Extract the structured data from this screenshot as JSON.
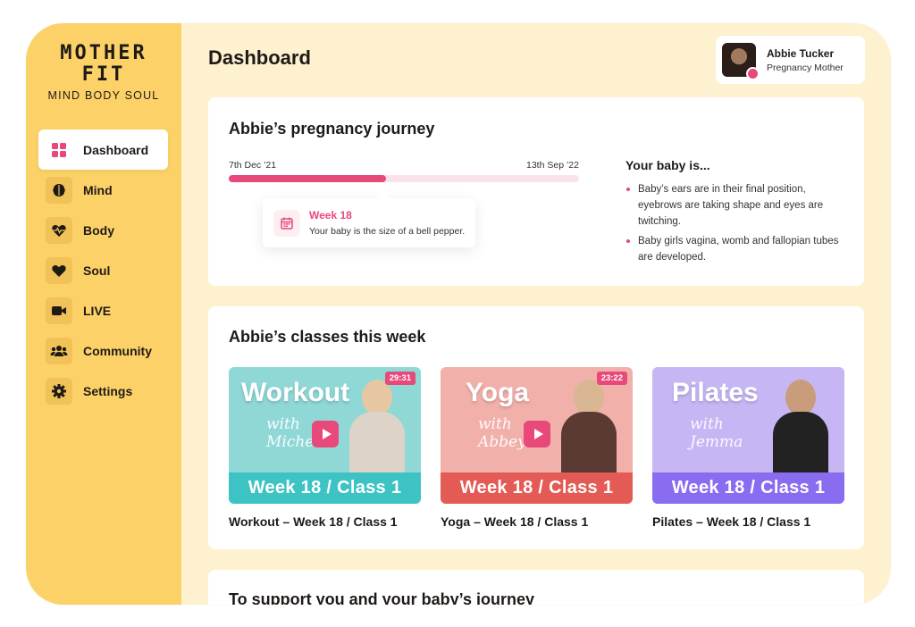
{
  "brand": {
    "name_line1": "MOTHER",
    "name_line2": "FIT",
    "tagline": "MIND BODY SOUL",
    "accent_color": "#e8497a",
    "sidebar_color": "#fcd268"
  },
  "sidebar": {
    "items": [
      {
        "label": "Dashboard",
        "icon": "grid-icon",
        "active": true
      },
      {
        "label": "Mind",
        "icon": "brain-icon"
      },
      {
        "label": "Body",
        "icon": "heartbeat-icon"
      },
      {
        "label": "Soul",
        "icon": "heart-icon"
      },
      {
        "label": "LIVE",
        "icon": "video-camera-icon"
      },
      {
        "label": "Community",
        "icon": "users-icon"
      },
      {
        "label": "Settings",
        "icon": "gear-icon"
      }
    ]
  },
  "header": {
    "title": "Dashboard",
    "user": {
      "name": "Abbie Tucker",
      "role": "Pregnancy Mother"
    }
  },
  "journey": {
    "title": "Abbie’s pregnancy journey",
    "start_date": "7th Dec ’21",
    "end_date": "13th Sep ’22",
    "progress": 0.45,
    "week": {
      "title": "Week 18",
      "description": "Your baby is the size of a bell pepper."
    },
    "baby": {
      "title": "Your baby is...",
      "facts": [
        "Baby’s ears are in their final position, eyebrows are taking shape and eyes are twitching.",
        "Baby girls vagina, womb and fallopian tubes are developed."
      ]
    }
  },
  "classes": {
    "title": "Abbie’s classes this week",
    "items": [
      {
        "word": "Workout",
        "with": "with",
        "instructor": "Michelle",
        "duration": "29:31",
        "banner": "Week 18 / Class 1",
        "caption": "Workout – Week 18 / Class 1",
        "bg": "#8fd8d6",
        "banner_color": "#3dc3c4"
      },
      {
        "word": "Yoga",
        "with": "with",
        "instructor": "Abbey",
        "duration": "23:22",
        "banner": "Week 18 / Class 1",
        "caption": "Yoga – Week 18 / Class 1",
        "bg": "#f2b0aa",
        "banner_color": "#e45a55"
      },
      {
        "word": "Pilates",
        "with": "with",
        "instructor": "Jemma",
        "duration": "",
        "banner": "Week 18 / Class 1",
        "caption": "Pilates – Week 18 / Class 1",
        "bg": "#c7b6f4",
        "banner_color": "#8a6cf0"
      }
    ]
  },
  "support": {
    "title": "To support you and your baby’s journey"
  }
}
